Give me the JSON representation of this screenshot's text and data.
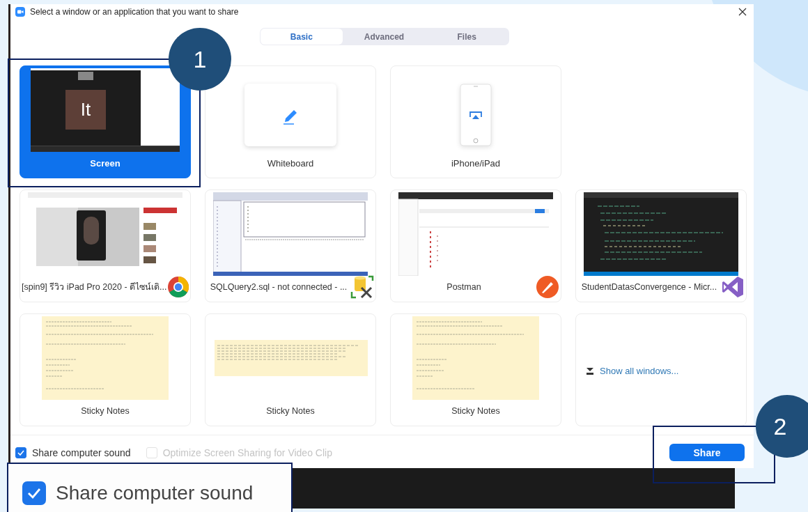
{
  "window": {
    "title": "Select a window or an application that you want to share"
  },
  "tabs": [
    {
      "label": "Basic",
      "selected": true
    },
    {
      "label": "Advanced",
      "selected": false
    },
    {
      "label": "Files",
      "selected": false
    }
  ],
  "tile_rows": [
    [
      {
        "kind": "screen",
        "label": "Screen",
        "selected": true,
        "preview_text": "It"
      },
      {
        "kind": "whiteboard",
        "label": "Whiteboard",
        "selected": false
      },
      {
        "kind": "device",
        "label": "iPhone/iPad",
        "selected": false
      }
    ],
    [
      {
        "kind": "browser",
        "label": "[spin9] รีวิว iPad Pro 2020 - ดีไซน์เดิ...",
        "selected": false
      },
      {
        "kind": "database",
        "label": "SQLQuery2.sql - not connected - ...",
        "selected": false
      },
      {
        "kind": "postman",
        "label": "Postman",
        "selected": false
      },
      {
        "kind": "editor",
        "label": "StudentDatasConvergence - Micr...",
        "selected": false
      }
    ],
    [
      {
        "kind": "note",
        "label": "Sticky Notes",
        "selected": false
      },
      {
        "kind": "strip",
        "label": "Sticky Notes",
        "selected": false
      },
      {
        "kind": "note",
        "label": "Sticky Notes",
        "selected": false
      },
      {
        "kind": "more",
        "label": "Show all windows...",
        "selected": false
      }
    ]
  ],
  "options": [
    {
      "label": "Share computer sound",
      "checked": true,
      "disabled": false
    },
    {
      "label": "Optimize Screen Sharing for Video Clip",
      "checked": false,
      "disabled": true
    }
  ],
  "share_button": "Share",
  "callout": {
    "label": "Share computer sound",
    "checked": true
  },
  "markers": [
    {
      "label": "1"
    },
    {
      "label": "2"
    }
  ]
}
